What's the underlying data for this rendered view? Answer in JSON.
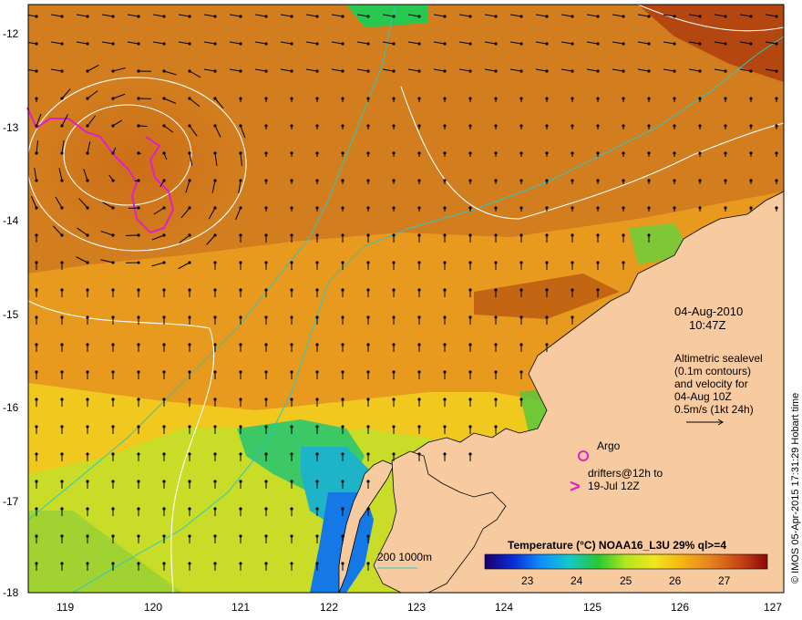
{
  "date": "04-Aug-2010",
  "time": "10:47Z",
  "altimetry": {
    "line1": "Altimetric sealevel",
    "line2": "(0.1m contours)",
    "line3": "and velocity for",
    "line4": "04-Aug 10Z",
    "scale": "0.5m/s (1kt 24h)"
  },
  "legend": {
    "argo": "Argo",
    "drifters_line1": "drifters@12h to",
    "drifters_line2": "19-Jul 12Z",
    "drifter_marker": ">"
  },
  "colorbar": {
    "title": "Temperature (°C) NOAA16_L3U 29% ql>=4",
    "ticks": [
      "23",
      "24",
      "25",
      "26",
      "27"
    ],
    "colors": [
      "#1a006b",
      "#0a2bd6",
      "#0f8fff",
      "#14c8c8",
      "#25c832",
      "#b4e61e",
      "#f0e61e",
      "#f5b414",
      "#e6821e",
      "#c84614",
      "#8c0a0a"
    ]
  },
  "bathymetry": {
    "label": "200  1000m"
  },
  "credit": "© IMOS 05-Apr-2015 17:31:29 Hobart time",
  "axes": {
    "lon_ticks": [
      "119",
      "120",
      "121",
      "122",
      "123",
      "124",
      "125",
      "126",
      "127"
    ],
    "lat_ticks": [
      "-12",
      "-13",
      "-14",
      "-15",
      "-16",
      "-17",
      "-18"
    ]
  },
  "colors": {
    "land": "#f8caa0",
    "contour": "#ffffff",
    "bathy": "#28c8c8",
    "drifter": "#e020c8"
  }
}
